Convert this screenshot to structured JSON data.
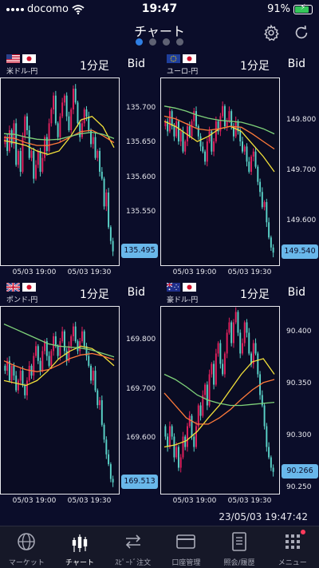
{
  "status_bar": {
    "carrier": "docomo",
    "time": "19:47",
    "battery": "91%",
    "battery_level": 0.91
  },
  "header": {
    "title": "チャート",
    "page_count": 4,
    "active_page": 0,
    "settings_icon": "gear-icon",
    "refresh_icon": "refresh-icon"
  },
  "colors": {
    "background": "#0b0d2a",
    "candle_up": "#e2215d",
    "candle_down": "#5ad2c8",
    "ma_yellow": "#f2e03a",
    "ma_orange": "#ff7a3a",
    "ma_green": "#7fd37a",
    "price_badge": "#69b7ea",
    "active_dot": "#2f7fe4"
  },
  "panels": [
    {
      "pair": "米ドル-円",
      "flags": [
        "us",
        "jp"
      ],
      "timeframe": "1分足",
      "price_type": "Bid",
      "current_price": "135.495",
      "x_labels": [
        "05/03 19:00",
        "05/03 19:30"
      ],
      "chart_data": {
        "type": "candlestick",
        "y_ticks": [
          "135.700",
          "135.650",
          "135.600",
          "135.550"
        ],
        "y_tick_values": [
          135.7,
          135.65,
          135.6,
          135.55
        ],
        "ylim": [
          135.475,
          135.745
        ],
        "close": [
          135.66,
          135.64,
          135.67,
          135.65,
          135.68,
          135.62,
          135.64,
          135.61,
          135.66,
          135.69,
          135.67,
          135.63,
          135.64,
          135.6,
          135.62,
          135.64,
          135.61,
          135.63,
          135.66,
          135.64,
          135.68,
          135.7,
          135.72,
          135.68,
          135.66,
          135.69,
          135.71,
          135.72,
          135.69,
          135.67,
          135.7,
          135.73,
          135.71,
          135.68,
          135.66,
          135.68,
          135.7,
          135.69,
          135.67,
          135.65,
          135.66,
          135.63,
          135.64,
          135.61,
          135.6,
          135.56,
          135.58,
          135.53,
          135.51,
          135.495
        ],
        "open_first": 135.65,
        "ma": [
          {
            "color": "#f2e03a",
            "values": [
              135.655,
              135.652,
              135.648,
              135.64,
              135.635,
              135.64,
              135.66,
              135.685,
              135.69,
              135.675,
              135.645
            ]
          },
          {
            "color": "#ff7a3a",
            "values": [
              135.66,
              135.658,
              135.652,
              135.648,
              135.648,
              135.652,
              135.66,
              135.668,
              135.67,
              135.662,
              135.652
            ]
          },
          {
            "color": "#7fd37a",
            "values": [
              135.665,
              135.664,
              135.66,
              135.657,
              135.656,
              135.657,
              135.661,
              135.665,
              135.667,
              135.664,
              135.658
            ]
          }
        ]
      }
    },
    {
      "pair": "ユーロ-円",
      "flags": [
        "eu",
        "jp"
      ],
      "timeframe": "1分足",
      "price_type": "Bid",
      "current_price": "149.540",
      "x_labels": [
        "05/03 19:00",
        "05/03 19:30"
      ],
      "chart_data": {
        "type": "candlestick",
        "y_ticks": [
          "149.800",
          "149.700",
          "149.600"
        ],
        "y_tick_values": [
          149.8,
          149.7,
          149.6
        ],
        "ylim": [
          149.515,
          149.885
        ],
        "close": [
          149.8,
          149.78,
          149.82,
          149.79,
          149.77,
          149.8,
          149.76,
          149.78,
          149.74,
          149.76,
          149.79,
          149.77,
          149.8,
          149.82,
          149.79,
          149.77,
          149.75,
          149.74,
          149.72,
          149.76,
          149.78,
          149.74,
          149.76,
          149.8,
          149.78,
          149.81,
          149.83,
          149.79,
          149.8,
          149.82,
          149.79,
          149.77,
          149.8,
          149.78,
          149.76,
          149.74,
          149.75,
          149.72,
          149.7,
          149.73,
          149.74,
          149.71,
          149.68,
          149.66,
          149.63,
          149.64,
          149.6,
          149.57,
          149.55,
          149.54
        ],
        "open_first": 149.79,
        "ma": [
          {
            "color": "#f2e03a",
            "values": [
              149.8,
              149.79,
              149.775,
              149.76,
              149.77,
              149.785,
              149.79,
              149.78,
              149.755,
              149.73,
              149.7
            ]
          },
          {
            "color": "#ff7a3a",
            "values": [
              149.81,
              149.805,
              149.795,
              149.785,
              149.782,
              149.785,
              149.79,
              149.788,
              149.775,
              149.76,
              149.745
            ]
          },
          {
            "color": "#7fd37a",
            "values": [
              149.83,
              149.826,
              149.82,
              149.812,
              149.806,
              149.802,
              149.8,
              149.798,
              149.792,
              149.785,
              149.775
            ]
          }
        ]
      }
    },
    {
      "pair": "ポンド-円",
      "flags": [
        "gb",
        "jp"
      ],
      "timeframe": "1分足",
      "price_type": "Bid",
      "current_price": "169.513",
      "x_labels": [
        "05/03 19:00",
        "05/03 19:30"
      ],
      "chart_data": {
        "type": "candlestick",
        "y_ticks": [
          "169.800",
          "169.700",
          "169.600"
        ],
        "y_tick_values": [
          169.8,
          169.7,
          169.6
        ],
        "ylim": [
          169.49,
          169.87
        ],
        "close": [
          169.74,
          169.76,
          169.72,
          169.75,
          169.73,
          169.7,
          169.72,
          169.74,
          169.71,
          169.69,
          169.72,
          169.75,
          169.73,
          169.77,
          169.79,
          169.76,
          169.74,
          169.78,
          169.8,
          169.77,
          169.75,
          169.78,
          169.81,
          169.79,
          169.77,
          169.8,
          169.82,
          169.78,
          169.76,
          169.79,
          169.81,
          169.83,
          169.8,
          169.78,
          169.8,
          169.82,
          169.79,
          169.77,
          169.75,
          169.72,
          169.74,
          169.7,
          169.67,
          169.68,
          169.63,
          169.6,
          169.57,
          169.55,
          169.52,
          169.513
        ],
        "open_first": 169.75,
        "ma": [
          {
            "color": "#f2e03a",
            "values": [
              169.72,
              169.715,
              169.71,
              169.72,
              169.74,
              169.765,
              169.78,
              169.79,
              169.785,
              169.77,
              169.75
            ]
          },
          {
            "color": "#ff7a3a",
            "values": [
              169.76,
              169.75,
              169.742,
              169.738,
              169.742,
              169.752,
              169.765,
              169.772,
              169.775,
              169.77,
              169.762
            ]
          },
          {
            "color": "#7fd37a",
            "values": [
              169.835,
              169.825,
              169.815,
              169.805,
              169.795,
              169.79,
              169.788,
              169.786,
              169.782,
              169.775,
              169.768
            ]
          }
        ]
      }
    },
    {
      "pair": "豪ドル-円",
      "flags": [
        "au",
        "jp"
      ],
      "timeframe": "1分足",
      "price_type": "Bid",
      "current_price": "90.266",
      "x_labels": [
        "05/03 19:00",
        "05/03 19:30"
      ],
      "chart_data": {
        "type": "candlestick",
        "y_ticks": [
          "90.400",
          "90.350",
          "90.300",
          "90.250"
        ],
        "y_tick_values": [
          90.4,
          90.35,
          90.3,
          90.25
        ],
        "ylim": [
          90.245,
          90.425
        ],
        "close": [
          90.3,
          90.29,
          90.31,
          90.3,
          90.28,
          90.29,
          90.27,
          90.28,
          90.3,
          90.29,
          90.31,
          90.32,
          90.3,
          90.29,
          90.31,
          90.33,
          90.32,
          90.34,
          90.35,
          90.33,
          90.36,
          90.37,
          90.35,
          90.38,
          90.39,
          90.37,
          90.36,
          90.38,
          90.4,
          90.41,
          90.39,
          90.41,
          90.42,
          90.4,
          90.38,
          90.39,
          90.41,
          90.4,
          90.38,
          90.37,
          90.39,
          90.38,
          90.36,
          90.34,
          90.33,
          90.31,
          90.29,
          90.28,
          90.27,
          90.266
        ],
        "open_first": 90.31,
        "ma": [
          {
            "color": "#f2e03a",
            "values": [
              90.29,
              90.292,
              90.296,
              90.305,
              90.318,
              90.33,
              90.345,
              90.36,
              90.372,
              90.375,
              90.36
            ]
          },
          {
            "color": "#ff7a3a",
            "values": [
              90.342,
              90.33,
              90.318,
              90.312,
              90.312,
              90.318,
              90.326,
              90.336,
              90.345,
              90.352,
              90.355
            ]
          },
          {
            "color": "#7fd37a",
            "values": [
              90.36,
              90.355,
              90.348,
              90.34,
              90.335,
              90.332,
              90.33,
              90.33,
              90.331,
              90.332,
              90.333
            ]
          }
        ]
      }
    }
  ],
  "timestamp": "23/05/03 19:47:42",
  "tabs": [
    {
      "label": "マーケット",
      "icon": "globe-icon"
    },
    {
      "label": "チャート",
      "icon": "candlestick-icon",
      "active": true
    },
    {
      "label": "ｽﾋﾟｰﾄﾞ注文",
      "icon": "exchange-arrows-icon"
    },
    {
      "label": "口座管理",
      "icon": "card-icon"
    },
    {
      "label": "照会/履歴",
      "icon": "document-icon"
    },
    {
      "label": "メニュー",
      "icon": "menu-grid-icon",
      "notice": true
    }
  ]
}
